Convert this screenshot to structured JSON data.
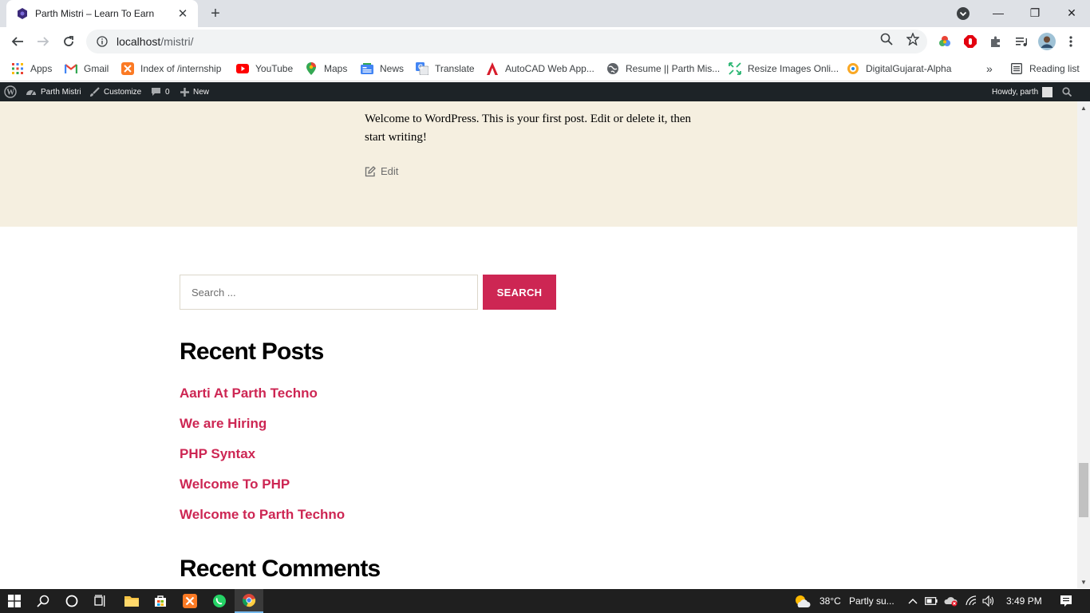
{
  "browser": {
    "tab_title": "Parth Mistri – Learn To Earn",
    "tab_close": "✕",
    "new_tab": "+",
    "url_host": "localhost",
    "url_path": "/mistri/",
    "window_controls": {
      "minimize": "—",
      "maximize": "❐",
      "close": "✕"
    }
  },
  "bookmarks": {
    "items": [
      {
        "label": "Apps",
        "icon": "apps-grid-icon"
      },
      {
        "label": "Gmail",
        "icon": "gmail-icon"
      },
      {
        "label": "Index of /internship",
        "icon": "xampp-icon"
      },
      {
        "label": "YouTube",
        "icon": "youtube-icon"
      },
      {
        "label": "Maps",
        "icon": "maps-icon"
      },
      {
        "label": "News",
        "icon": "news-icon"
      },
      {
        "label": "Translate",
        "icon": "translate-icon"
      },
      {
        "label": "AutoCAD Web App...",
        "icon": "autocad-icon"
      },
      {
        "label": "Resume || Parth Mis...",
        "icon": "globe-icon"
      },
      {
        "label": "Resize Images Onli...",
        "icon": "resize-icon"
      },
      {
        "label": "DigitalGujarat-Alpha",
        "icon": "digitalgujarat-icon"
      }
    ],
    "more": "»",
    "reading_list": "Reading list"
  },
  "admin_bar": {
    "site_name": "Parth Mistri",
    "customize": "Customize",
    "comments_count": "0",
    "new_label": "New",
    "howdy": "Howdy, parth"
  },
  "post": {
    "body": "Welcome to WordPress. This is your first post. Edit or delete it, then start writing!",
    "edit_label": "Edit"
  },
  "search": {
    "placeholder": "Search ...",
    "button_label": "SEARCH"
  },
  "recent_posts": {
    "title": "Recent Posts",
    "items": [
      "Aarti At Parth Techno",
      "We are Hiring",
      "PHP Syntax",
      "Welcome To PHP",
      "Welcome to Parth Techno"
    ]
  },
  "recent_comments": {
    "title": "Recent Comments"
  },
  "taskbar": {
    "weather_temp": "38°C",
    "weather_desc": "Partly su...",
    "time": "3:49 PM"
  },
  "colors": {
    "accent": "#cd2653",
    "band_bg": "#f5efe0",
    "admin_bar": "#1d2327"
  }
}
